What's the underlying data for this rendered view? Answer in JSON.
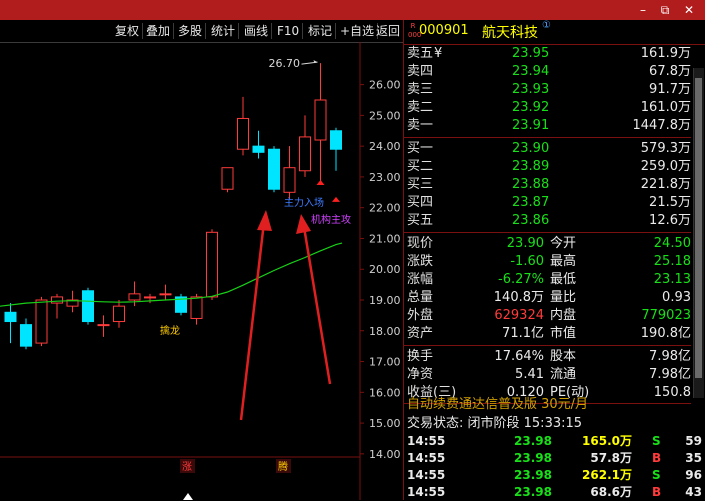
{
  "toolbar": {
    "buttons": [
      "复权",
      "叠加",
      "多股",
      "统计",
      "画线",
      "F10",
      "标记",
      "+自选",
      "返回"
    ]
  },
  "chart": {
    "y_ticks": [
      "26.00",
      "25.00",
      "24.00",
      "23.00",
      "22.00",
      "21.00",
      "20.00",
      "19.00",
      "18.00",
      "17.00",
      "16.00",
      "15.00",
      "14.00"
    ],
    "max_label": "26.70",
    "annotations": {
      "zhuli": "主力入场",
      "jigou": "机构主攻",
      "qinlong": "擒龙",
      "zhang": "涨",
      "teng": "腾"
    },
    "colors": {
      "up": "#ff3b3b",
      "down": "#00e5ff",
      "ma": "#18d018",
      "grid": "#7a1010"
    }
  },
  "chart_data": {
    "type": "candlestick",
    "series": [
      {
        "name": "candles",
        "values": [
          {
            "o": 18.6,
            "h": 18.9,
            "l": 17.6,
            "c": 18.3
          },
          {
            "o": 18.2,
            "h": 18.4,
            "l": 17.4,
            "c": 17.5
          },
          {
            "o": 17.6,
            "h": 19.1,
            "l": 17.5,
            "c": 19.0
          },
          {
            "o": 18.9,
            "h": 19.2,
            "l": 18.4,
            "c": 19.1
          },
          {
            "o": 18.8,
            "h": 19.3,
            "l": 18.6,
            "c": 19.0
          },
          {
            "o": 19.3,
            "h": 19.4,
            "l": 18.2,
            "c": 18.3
          },
          {
            "o": 18.2,
            "h": 18.5,
            "l": 17.8,
            "c": 18.2
          },
          {
            "o": 18.3,
            "h": 19.0,
            "l": 18.1,
            "c": 18.8
          },
          {
            "o": 19.0,
            "h": 19.6,
            "l": 18.8,
            "c": 19.2
          },
          {
            "o": 19.1,
            "h": 19.2,
            "l": 18.9,
            "c": 19.1
          },
          {
            "o": 19.2,
            "h": 19.5,
            "l": 19.0,
            "c": 19.2
          },
          {
            "o": 19.1,
            "h": 19.2,
            "l": 18.5,
            "c": 18.6
          },
          {
            "o": 18.4,
            "h": 19.2,
            "l": 18.2,
            "c": 19.1
          },
          {
            "o": 19.1,
            "h": 21.3,
            "l": 19.0,
            "c": 21.2
          },
          {
            "o": 22.6,
            "h": 23.3,
            "l": 22.5,
            "c": 23.3
          },
          {
            "o": 23.9,
            "h": 25.6,
            "l": 23.7,
            "c": 24.9
          },
          {
            "o": 24.0,
            "h": 24.5,
            "l": 23.6,
            "c": 23.8
          },
          {
            "o": 23.9,
            "h": 24.0,
            "l": 22.5,
            "c": 22.6
          },
          {
            "o": 22.5,
            "h": 24.0,
            "l": 22.3,
            "c": 23.3
          },
          {
            "o": 23.2,
            "h": 25.0,
            "l": 23.0,
            "c": 24.3
          },
          {
            "o": 24.2,
            "h": 26.7,
            "l": 22.8,
            "c": 25.5
          },
          {
            "o": 24.5,
            "h": 24.6,
            "l": 23.2,
            "c": 23.9
          }
        ]
      },
      {
        "name": "ma",
        "values": [
          18.8,
          18.9,
          18.93,
          18.96,
          18.98,
          18.96,
          18.94,
          18.93,
          18.94,
          18.97,
          19.0,
          19.03,
          19.06,
          19.12,
          19.26,
          19.48,
          19.72,
          19.96,
          20.18,
          20.38,
          20.6,
          20.8
        ]
      }
    ],
    "ylim": [
      13.8,
      26.8
    ]
  },
  "stock": {
    "badge": "R 000",
    "code": "000901",
    "name": "航天科技",
    "info_mark": "①"
  },
  "sell": [
    {
      "label": "卖五",
      "suffix": "¥",
      "price": "23.95",
      "vol": "161.9万"
    },
    {
      "label": "卖四",
      "suffix": "",
      "price": "23.94",
      "vol": "67.8万"
    },
    {
      "label": "卖三",
      "suffix": "",
      "price": "23.93",
      "vol": "91.7万"
    },
    {
      "label": "卖二",
      "suffix": "",
      "price": "23.92",
      "vol": "161.0万"
    },
    {
      "label": "卖一",
      "suffix": "",
      "price": "23.91",
      "vol": "1447.8万"
    }
  ],
  "buy": [
    {
      "label": "买一",
      "price": "23.90",
      "vol": "579.3万"
    },
    {
      "label": "买二",
      "price": "23.89",
      "vol": "259.0万"
    },
    {
      "label": "买三",
      "price": "23.88",
      "vol": "221.8万"
    },
    {
      "label": "买四",
      "price": "23.87",
      "vol": "21.5万"
    },
    {
      "label": "买五",
      "price": "23.86",
      "vol": "12.6万"
    }
  ],
  "quote": [
    {
      "l1": "现价",
      "v1": "23.90",
      "c1": "green",
      "l2": "今开",
      "v2": "24.50",
      "c2": "green"
    },
    {
      "l1": "涨跌",
      "v1": "-1.60",
      "c1": "green",
      "l2": "最高",
      "v2": "25.18",
      "c2": "green"
    },
    {
      "l1": "涨幅",
      "v1": "-6.27%",
      "c1": "green",
      "l2": "最低",
      "v2": "23.13",
      "c2": "green"
    },
    {
      "l1": "总量",
      "v1": "140.8万",
      "c1": "white",
      "l2": "量比",
      "v2": "0.93",
      "c2": "white"
    },
    {
      "l1": "外盘",
      "v1": "629324",
      "c1": "red",
      "l2": "内盘",
      "v2": "779023",
      "c2": "green"
    },
    {
      "l1": "资产",
      "v1": "71.1亿",
      "c1": "white",
      "l2": "市值",
      "v2": "190.8亿",
      "c2": "white"
    }
  ],
  "fund": [
    {
      "l1": "换手",
      "v1": "17.64%",
      "l2": "股本",
      "v2": "7.98亿"
    },
    {
      "l1": "净资",
      "v1": "5.41",
      "l2": "流通",
      "v2": "7.98亿"
    },
    {
      "l1": "收益(三)",
      "v1": "0.120",
      "l2": "PE(动)",
      "v2": "150.8"
    }
  ],
  "ad": "自动续费通达信普及版  30元/月",
  "trade_status": "交易状态: 闭市阶段 15:33:15",
  "ticks": [
    {
      "time": "14:55",
      "price": "23.98",
      "vol": "165.0万",
      "vc": "yellow",
      "bs": "S",
      "bc": "green",
      "n": "59"
    },
    {
      "time": "14:55",
      "price": "23.98",
      "vol": "57.8万",
      "vc": "white",
      "bs": "B",
      "bc": "red",
      "n": "35"
    },
    {
      "time": "14:55",
      "price": "23.98",
      "vol": "262.1万",
      "vc": "yellow",
      "bs": "S",
      "bc": "green",
      "n": "96"
    },
    {
      "time": "14:55",
      "price": "23.98",
      "vol": "68.6万",
      "vc": "white",
      "bs": "B",
      "bc": "red",
      "n": "43"
    }
  ]
}
